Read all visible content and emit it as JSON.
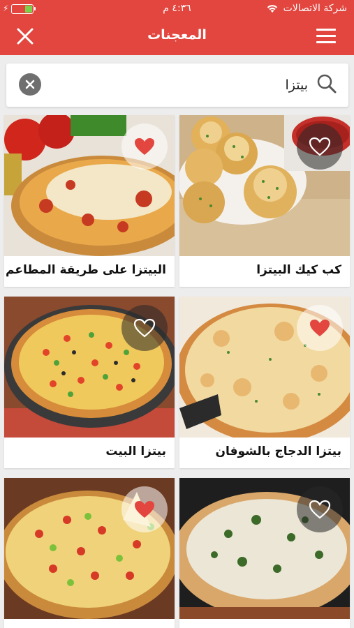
{
  "status_bar": {
    "carrier": "شركة الاتصالات",
    "time": "٤:٣٦ م",
    "battery_color": "#7bd24a"
  },
  "header": {
    "title": "المعجنات",
    "close_icon": "close-icon",
    "menu_icon": "hamburger-menu-icon",
    "background": "#e2463f"
  },
  "search": {
    "value": "بيتزا",
    "icon": "search-icon",
    "clear_icon": "clear-icon"
  },
  "recipes": [
    {
      "title": "كب كيك البيتزا",
      "favorite": false
    },
    {
      "title": "البيتزا على طريقة المطاعم",
      "favorite": true
    },
    {
      "title": "بيتزا الدجاج بالشوفان",
      "favorite": true
    },
    {
      "title": "بيتزا البيت",
      "favorite": false
    },
    {
      "title": "",
      "favorite": false
    },
    {
      "title": "",
      "favorite": true
    }
  ]
}
